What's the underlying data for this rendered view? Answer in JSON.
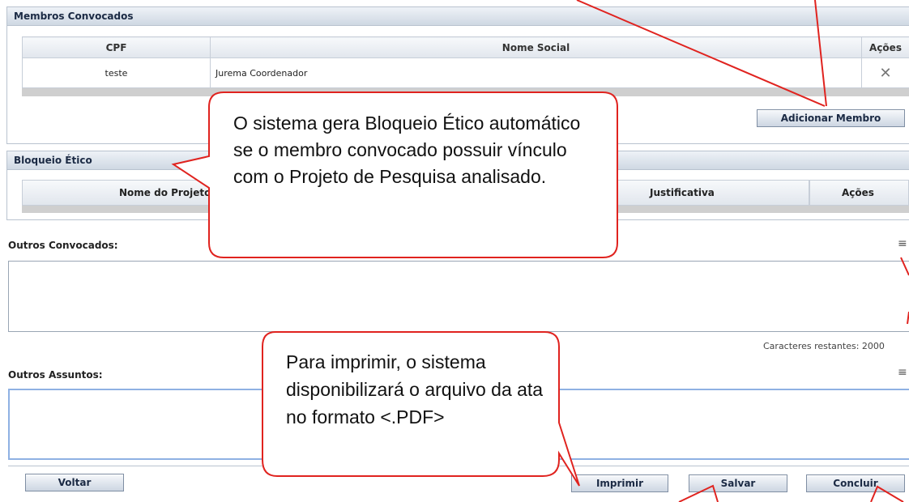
{
  "membros": {
    "title": "Membros Convocados",
    "columns": [
      "CPF",
      "Nome Social",
      "Ações"
    ],
    "rows": [
      {
        "cpf": "teste",
        "nome": "Jurema Coordenador",
        "acao_icon": "close-icon"
      }
    ],
    "add_button": "Adicionar Membro"
  },
  "bloqueio": {
    "title": "Bloqueio Ético",
    "columns": [
      "Nome do Projeto",
      "Justificativa",
      "Ações"
    ]
  },
  "outros_convocados": {
    "label": "Outros Convocados:",
    "remaining": "Caracteres restantes: 2000"
  },
  "outros_assuntos": {
    "label": "Outros Assuntos:"
  },
  "footer": {
    "voltar": "Voltar",
    "imprimir": "Imprimir",
    "salvar": "Salvar",
    "concluir": "Concluir"
  },
  "callouts": {
    "bloqueio_note": "O sistema gera Bloqueio Ético automático se o membro convocado possuir vínculo com o Projeto de Pesquisa analisado.",
    "print_note": "Para imprimir, o sistema disponibilizará o arquivo da ata no formato <.PDF>"
  },
  "colors": {
    "callout_border": "#e0231f",
    "panel_header": "#cfd8e3"
  }
}
